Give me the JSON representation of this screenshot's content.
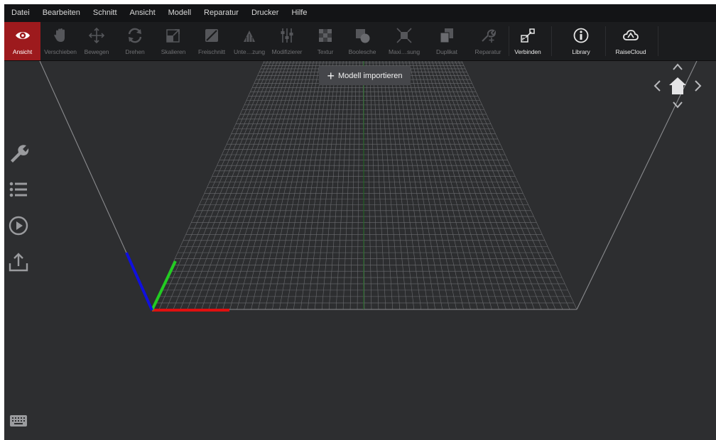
{
  "menu": [
    "Datei",
    "Bearbeiten",
    "Schnitt",
    "Ansicht",
    "Modell",
    "Reparatur",
    "Drucker",
    "Hilfe"
  ],
  "toolbar": {
    "ansicht": "Ansicht",
    "verschieben": "Verschieben",
    "bewegen": "Bewegen",
    "drehen": "Drehen",
    "skalieren": "Skalieren",
    "freischnitt": "Freischnitt",
    "unterstuetzung": "Unte…zung",
    "modifizierer": "Modifizierer",
    "textur": "Textur",
    "boolesche": "Boolesche",
    "maximierung": "Maxi…sung",
    "duplikat": "Duplikat",
    "reparatur": "Reparatur",
    "verbinden": "Verbinden",
    "library": "Library",
    "raisecloud": "RaiseCloud"
  },
  "import_button": {
    "label": "Modell importieren",
    "icon": "plus-icon"
  },
  "sidebar": [
    "wrench-icon",
    "list-icon",
    "play-icon",
    "export-icon"
  ],
  "navigation": [
    "chevron-up-icon",
    "chevron-left-icon",
    "home-icon",
    "chevron-right-icon",
    "chevron-down-icon"
  ],
  "colors": {
    "active_tool": "#9d1a1d",
    "axis_x": "#e01010",
    "axis_y": "#22cc22",
    "axis_z": "#1010dd",
    "grid": "#6b6c6f",
    "viewport": "#2d2e30"
  }
}
